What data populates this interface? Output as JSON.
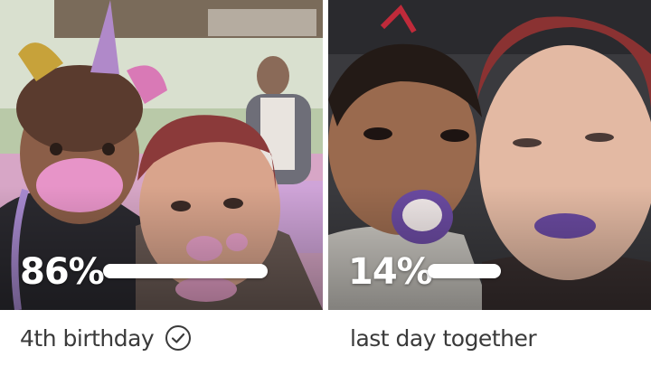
{
  "cards": [
    {
      "percent_text": "86%",
      "progress": 0.86,
      "caption": "4th birthday",
      "checked": true,
      "photo_description_icon": "photo"
    },
    {
      "percent_text": "14%",
      "progress": 0.14,
      "caption": "last day together",
      "checked": false,
      "photo_description_icon": "photo"
    }
  ],
  "colors": {
    "bar": "#ffffff",
    "text": "#3a3a3a",
    "lipstick": "#6a4aa0",
    "frosting": "#e88ac8"
  }
}
